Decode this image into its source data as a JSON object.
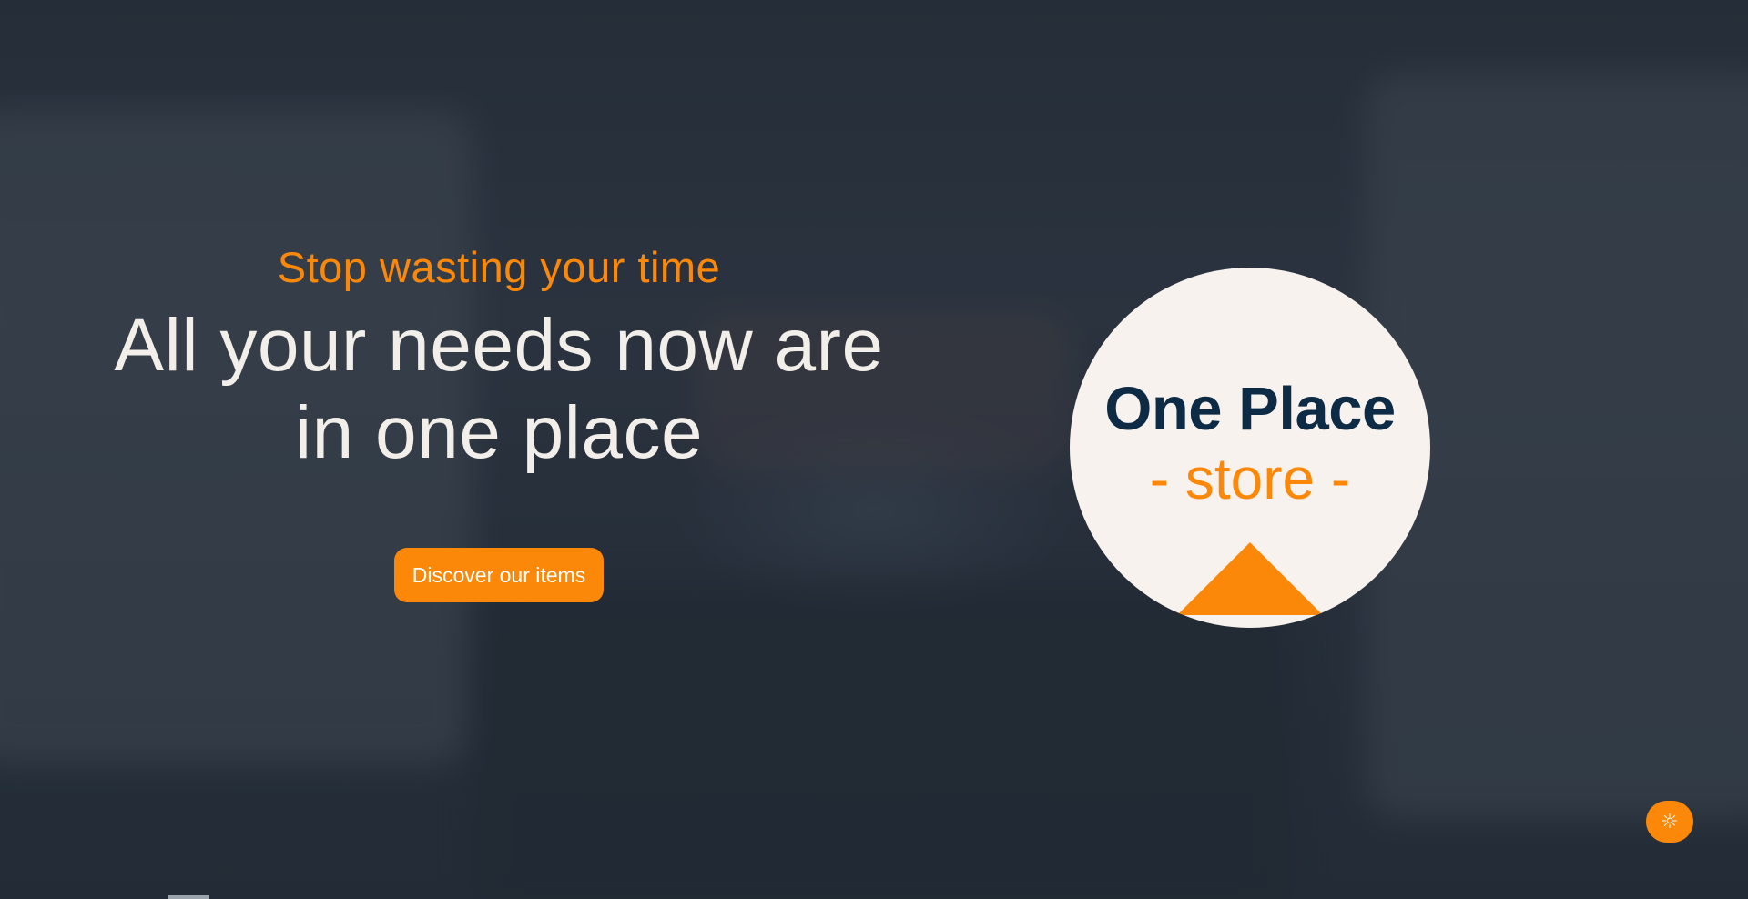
{
  "hero": {
    "tagline": "Stop wasting your time",
    "headline_line1": "All your needs now are",
    "headline_line2": "in one place",
    "cta_label": "Discover our items"
  },
  "logo": {
    "name": "One Place",
    "sub": "- store -"
  },
  "theme_toggle": {
    "icon": "sun-icon",
    "glyph": "☼"
  },
  "colors": {
    "accent": "#fb8808",
    "brand_dark": "#0d2b45",
    "badge_bg": "#f8f2ee",
    "headline": "#f2eee9"
  }
}
